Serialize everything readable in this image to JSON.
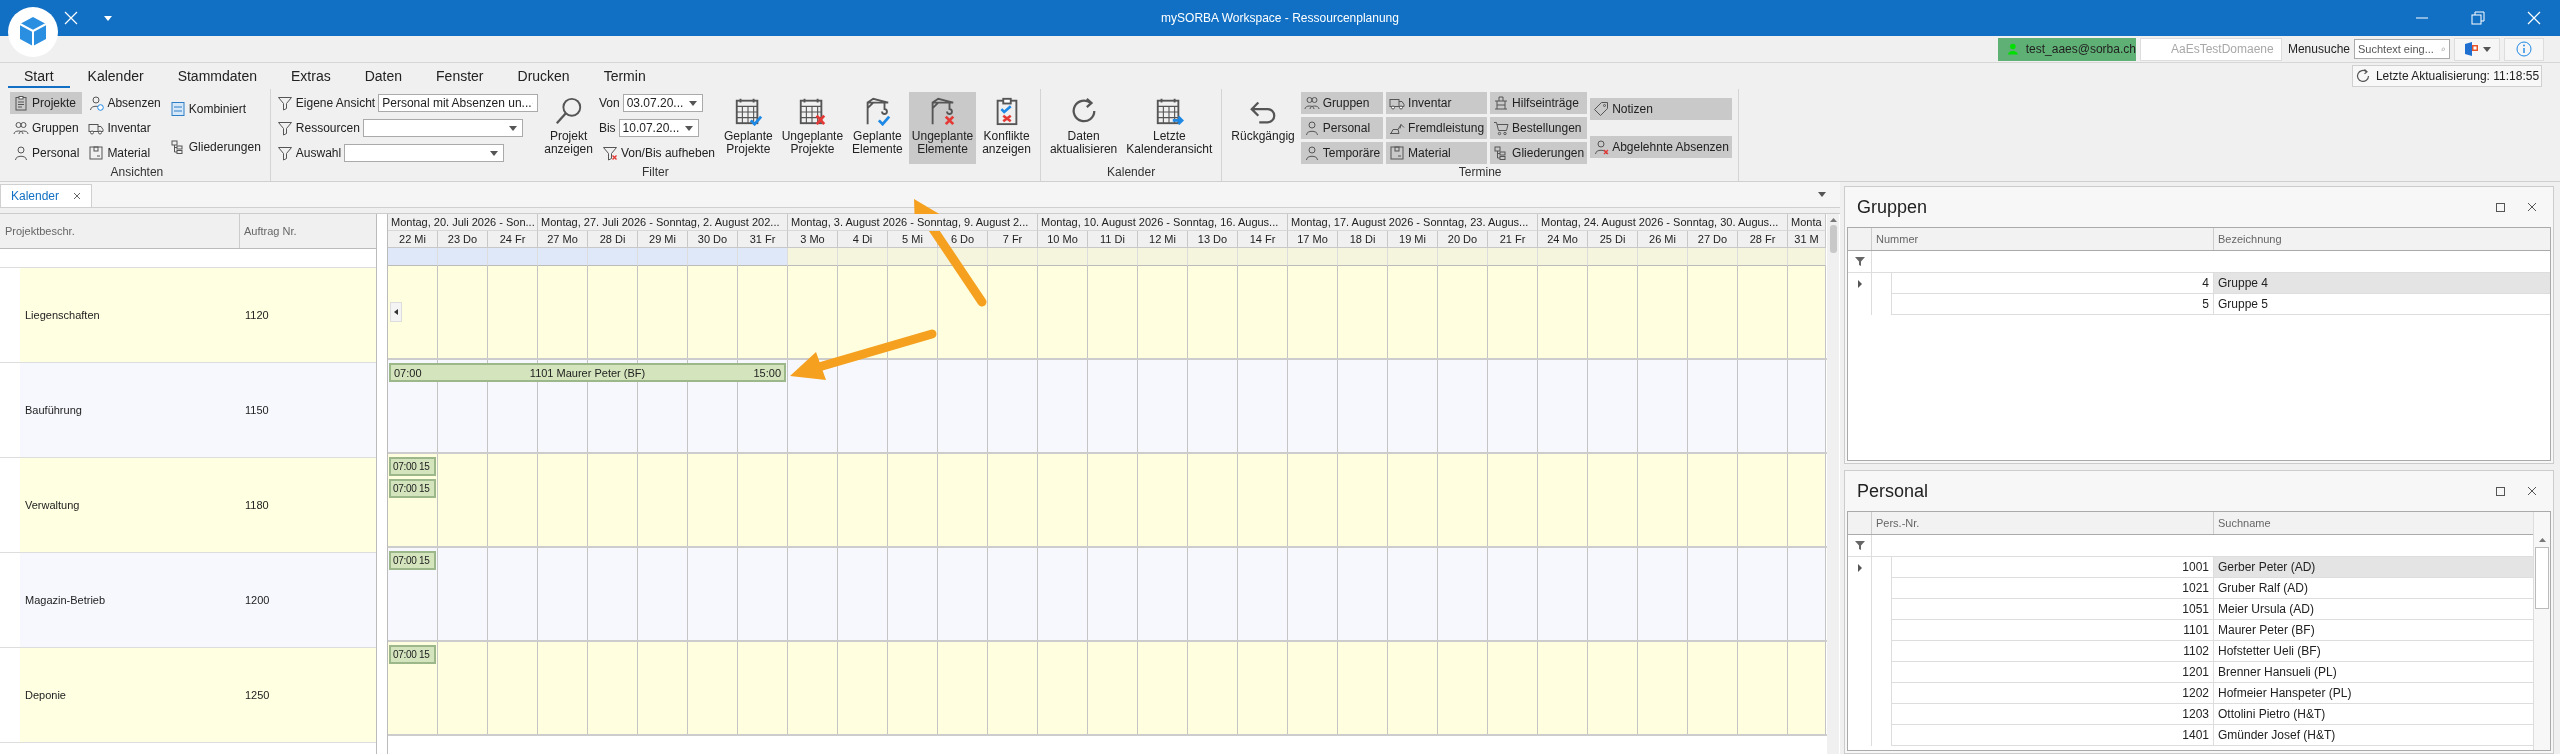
{
  "window": {
    "title": "mySORBA Workspace - Ressourcenplanung"
  },
  "account": {
    "user": "test_aaes@sorba.ch",
    "domain": "AaEsTestDomaene",
    "search_label": "Menusuche",
    "search_placeholder": "Suchtext eing..."
  },
  "ribbon": {
    "tabs": [
      {
        "label": "Start",
        "selected": true
      },
      {
        "label": "Kalender",
        "selected": false
      },
      {
        "label": "Stammdaten",
        "selected": false
      },
      {
        "label": "Extras",
        "selected": false
      },
      {
        "label": "Daten",
        "selected": false
      },
      {
        "label": "Fenster",
        "selected": false
      },
      {
        "label": "Drucken",
        "selected": false
      },
      {
        "label": "Termin",
        "selected": false
      }
    ],
    "last_update": "Letzte Aktualisierung: 11:18:55",
    "groups": [
      {
        "label": "Ansichten",
        "columns": [
          [
            {
              "kind": "small",
              "label": "Projekte",
              "selected": true
            },
            {
              "kind": "small",
              "label": "Gruppen",
              "selected": false
            },
            {
              "kind": "small",
              "label": "Personal",
              "selected": false
            }
          ],
          [
            {
              "kind": "small",
              "label": "Absenzen",
              "selected": false
            },
            {
              "kind": "small",
              "label": "Inventar",
              "selected": false
            },
            {
              "kind": "small",
              "label": "Material",
              "selected": false
            }
          ],
          [
            {
              "kind": "small",
              "label": "Kombiniert",
              "selected": false
            },
            {
              "kind": "small",
              "label": "Gliederungen",
              "selected": false
            }
          ]
        ]
      },
      {
        "label": "Filter",
        "columns": [
          [
            {
              "kind": "combo",
              "label": "Eigene Ansicht",
              "value": "Personal mit Absenzen un..."
            },
            {
              "kind": "combo",
              "label": "Ressourcen"
            },
            {
              "kind": "combo",
              "label": "Auswahl"
            }
          ],
          [
            {
              "kind": "big",
              "lines": [
                "Projekt",
                "anzeigen"
              ],
              "selected": false
            }
          ],
          [
            {
              "kind": "date",
              "label": "Von",
              "value": "03.07.20..."
            },
            {
              "kind": "date",
              "label": "Bis",
              "value": "10.07.20..."
            },
            {
              "kind": "small",
              "label": "Von/Bis aufheben",
              "selected": false
            }
          ],
          [
            {
              "kind": "big",
              "lines": [
                "Geplante",
                "Projekte"
              ],
              "selected": false
            }
          ],
          [
            {
              "kind": "big",
              "lines": [
                "Ungeplante",
                "Projekte"
              ],
              "selected": false
            }
          ],
          [
            {
              "kind": "big",
              "lines": [
                "Geplante",
                "Elemente"
              ],
              "selected": false
            }
          ],
          [
            {
              "kind": "big",
              "lines": [
                "Ungeplante",
                "Elemente"
              ],
              "selected": true
            }
          ],
          [
            {
              "kind": "big",
              "lines": [
                "Konflikte",
                "anzeigen"
              ],
              "selected": false
            }
          ]
        ]
      },
      {
        "label": "Kalender",
        "columns": [
          [
            {
              "kind": "big",
              "lines": [
                "Daten",
                "aktualisieren"
              ],
              "selected": false
            }
          ],
          [
            {
              "kind": "big",
              "lines": [
                "Letzte",
                "Kalenderansicht"
              ],
              "selected": false
            }
          ]
        ]
      },
      {
        "label": "Termine",
        "columns": [
          [
            {
              "kind": "big",
              "lines": [
                "Rückgängig"
              ],
              "selected": false
            }
          ],
          [
            {
              "kind": "small",
              "label": "Gruppen",
              "selected": true
            },
            {
              "kind": "small",
              "label": "Personal",
              "selected": true
            },
            {
              "kind": "small",
              "label": "Temporäre",
              "selected": true
            }
          ],
          [
            {
              "kind": "small",
              "label": "Inventar",
              "selected": true
            },
            {
              "kind": "small",
              "label": "Fremdleistung",
              "selected": true
            },
            {
              "kind": "small",
              "label": "Material",
              "selected": true
            }
          ],
          [
            {
              "kind": "small",
              "label": "Hilfseinträge",
              "selected": true
            },
            {
              "kind": "small",
              "label": "Bestellungen",
              "selected": true
            },
            {
              "kind": "small",
              "label": "Gliederungen",
              "selected": true
            }
          ],
          [
            {
              "kind": "small",
              "label": "Notizen",
              "selected": true
            },
            {
              "kind": "small",
              "label": "Abgelehnte Absenzen",
              "selected": true
            }
          ]
        ]
      }
    ]
  },
  "documents": [
    {
      "label": "Kalender",
      "selected": true
    }
  ],
  "calendar": {
    "columns": [
      "Projektbeschr.",
      "Auftrag Nr."
    ],
    "weeks": [
      {
        "label": "Montag, 20. Juli 2026 - Son...",
        "days": [
          {
            "label": "22 Mi",
            "shaded": true
          },
          {
            "label": "23 Do",
            "shaded": true
          },
          {
            "label": "24 Fr",
            "shaded": true
          }
        ]
      },
      {
        "label": "Montag, 27. Juli 2026 - Sonntag, 2. August 202...",
        "days": [
          {
            "label": "27 Mo",
            "shaded": true
          },
          {
            "label": "28 Di",
            "shaded": true
          },
          {
            "label": "29 Mi",
            "shaded": true
          },
          {
            "label": "30 Do",
            "shaded": true
          },
          {
            "label": "31 Fr",
            "shaded": true
          }
        ]
      },
      {
        "label": "Montag, 3. August 2026 - Sonntag, 9. August 2...",
        "days": [
          {
            "label": "3 Mo",
            "shaded": false
          },
          {
            "label": "4 Di",
            "shaded": false
          },
          {
            "label": "5 Mi",
            "shaded": false
          },
          {
            "label": "6 Do",
            "shaded": false
          },
          {
            "label": "7 Fr",
            "shaded": false
          }
        ]
      },
      {
        "label": "Montag, 10. August 2026 - Sonntag, 16. Augus...",
        "days": [
          {
            "label": "10 Mo",
            "shaded": false
          },
          {
            "label": "11 Di",
            "shaded": false
          },
          {
            "label": "12 Mi",
            "shaded": false
          },
          {
            "label": "13 Do",
            "shaded": false
          },
          {
            "label": "14 Fr",
            "shaded": false
          }
        ]
      },
      {
        "label": "Montag, 17. August 2026 - Sonntag, 23. Augus...",
        "days": [
          {
            "label": "17 Mo",
            "shaded": false
          },
          {
            "label": "18 Di",
            "shaded": false
          },
          {
            "label": "19 Mi",
            "shaded": false
          },
          {
            "label": "20 Do",
            "shaded": false
          },
          {
            "label": "21 Fr",
            "shaded": false
          }
        ]
      },
      {
        "label": "Montag, 24. August 2026 - Sonntag, 30. Augus...",
        "days": [
          {
            "label": "24 Mo",
            "shaded": false
          },
          {
            "label": "25 Di",
            "shaded": false
          },
          {
            "label": "26 Mi",
            "shaded": false
          },
          {
            "label": "27 Do",
            "shaded": false
          },
          {
            "label": "28 Fr",
            "shaded": false
          }
        ]
      },
      {
        "label": "Monta",
        "days": [
          {
            "label": "31 M",
            "shaded": false
          }
        ]
      }
    ],
    "rows": [
      {
        "name": "Liegenschaften",
        "order": "1120",
        "earlier_hint": true,
        "appointments": []
      },
      {
        "name": "Bauführung",
        "order": "1150",
        "earlier_hint": false,
        "appointments": [
          {
            "kind": "full",
            "start": "07:00",
            "label": "1101 Maurer Peter (BF)",
            "end": "15:00"
          }
        ]
      },
      {
        "name": "Verwaltung",
        "order": "1180",
        "earlier_hint": false,
        "appointments": [
          {
            "kind": "compact",
            "text": "07:00 15"
          },
          {
            "kind": "compact",
            "text": "07:00 15"
          }
        ]
      },
      {
        "name": "Magazin-Betrieb",
        "order": "1200",
        "earlier_hint": false,
        "appointments": [
          {
            "kind": "compact",
            "text": "07:00 15"
          }
        ]
      },
      {
        "name": "Deponie",
        "order": "1250",
        "earlier_hint": false,
        "appointments": [
          {
            "kind": "compact",
            "text": "07:00 15"
          }
        ]
      }
    ]
  },
  "panels": [
    {
      "title": "Gruppen",
      "columns": [
        "Nummer",
        "Bezeichnung"
      ],
      "rows": [
        {
          "cells": [
            "4",
            "Gruppe 4"
          ],
          "selected": true
        },
        {
          "cells": [
            "5",
            "Gruppe 5"
          ],
          "selected": false
        }
      ]
    },
    {
      "title": "Personal",
      "columns": [
        "Pers.-Nr.",
        "Suchname"
      ],
      "rows": [
        {
          "cells": [
            "1001",
            "Gerber Peter (AD)"
          ],
          "selected": true
        },
        {
          "cells": [
            "1021",
            "Gruber Ralf (AD)"
          ],
          "selected": false
        },
        {
          "cells": [
            "1051",
            "Meier Ursula (AD)"
          ],
          "selected": false
        },
        {
          "cells": [
            "1101",
            "Maurer Peter (BF)"
          ],
          "selected": false
        },
        {
          "cells": [
            "1102",
            "Hofstetter Ueli (BF)"
          ],
          "selected": false
        },
        {
          "cells": [
            "1201",
            "Brenner Hansueli (PL)"
          ],
          "selected": false
        },
        {
          "cells": [
            "1202",
            "Hofmeier Hanspeter (PL)"
          ],
          "selected": false
        },
        {
          "cells": [
            "1203",
            "Ottolini Pietro (H&T)"
          ],
          "selected": false
        },
        {
          "cells": [
            "1401",
            "Gmünder Josef (H&T)"
          ],
          "selected": false
        }
      ]
    }
  ]
}
